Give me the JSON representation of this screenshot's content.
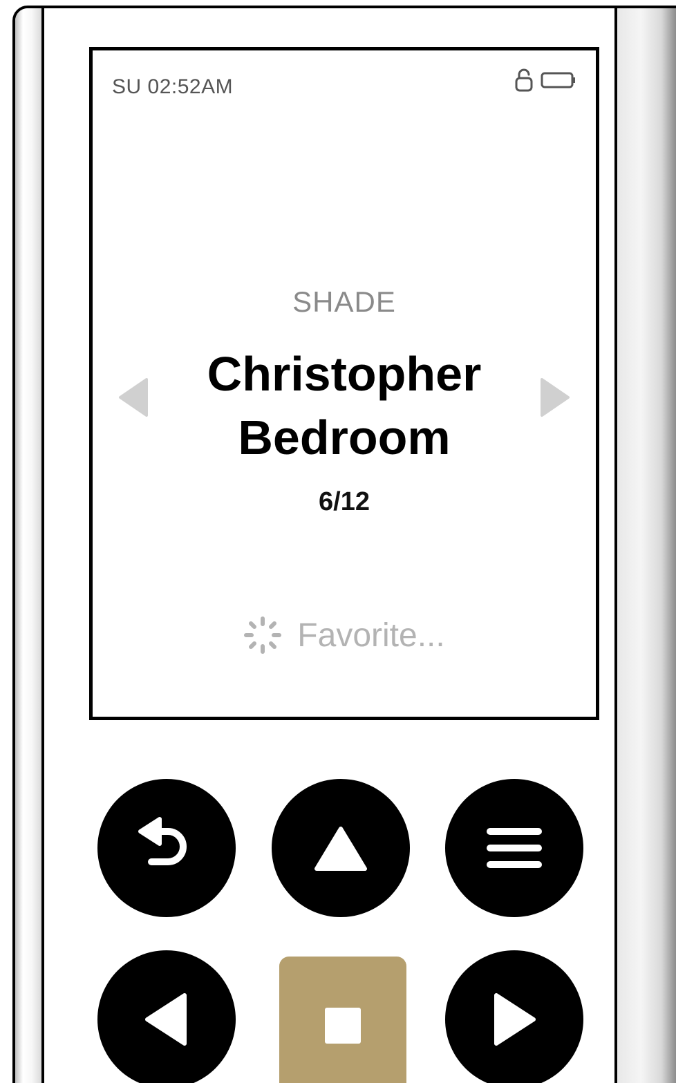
{
  "status_bar": {
    "time": "SU 02:52AM",
    "lock_icon": "unlocked-padlock-icon",
    "battery_icon": "battery-icon"
  },
  "screen": {
    "category": "SHADE",
    "device_name": "Christopher Bedroom",
    "counter": "6/12",
    "status_message": "Favorite...",
    "prev_icon": "triangle-left-icon",
    "next_icon": "triangle-right-icon",
    "spinner_icon": "loading-spinner-icon"
  },
  "buttons": {
    "back": "back-arrow-icon",
    "up": "up-triangle-icon",
    "menu": "hamburger-menu-icon",
    "left": "left-triangle-icon",
    "stop": "stop-square-icon",
    "right": "right-triangle-icon"
  },
  "colors": {
    "accent": "#b59f6e",
    "button": "#000000",
    "muted_text": "#8a8a8a",
    "disabled_arrow": "#d0d0d0"
  }
}
